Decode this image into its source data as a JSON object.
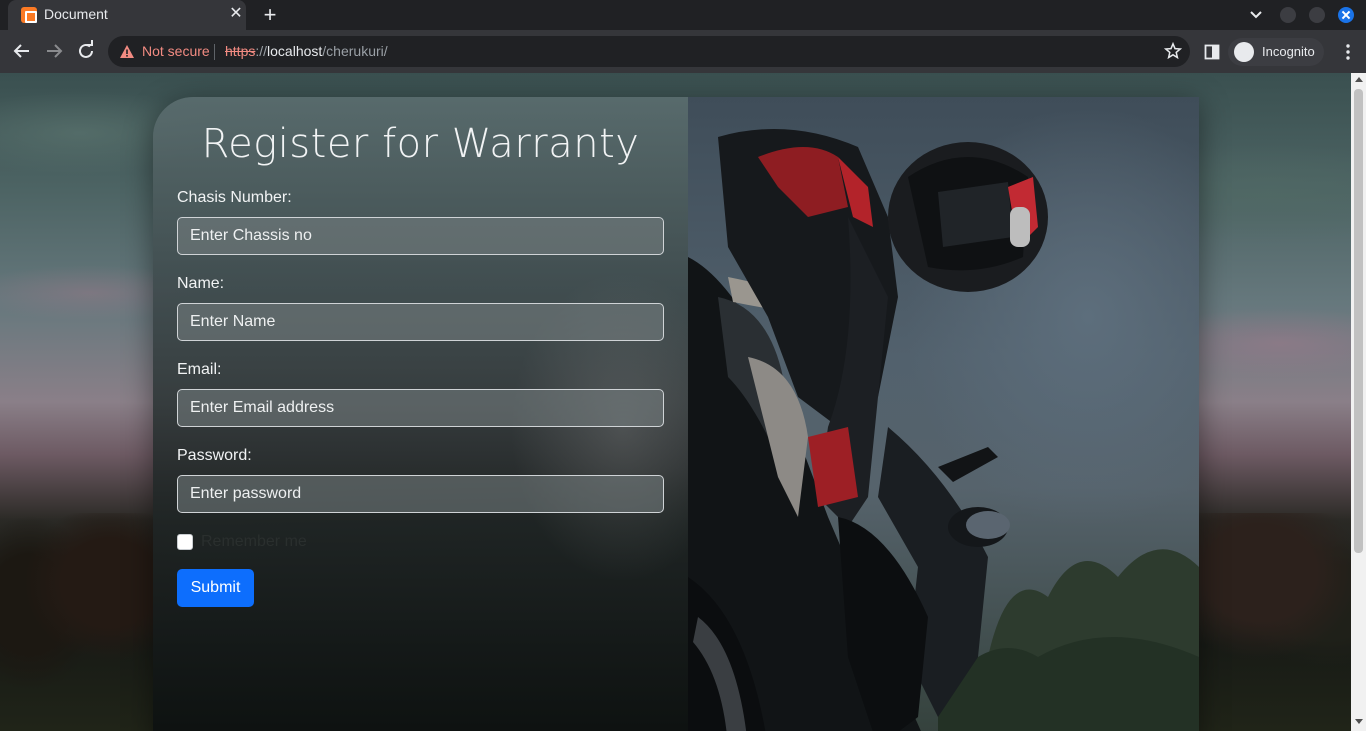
{
  "browser": {
    "tab_title": "Document",
    "tab_close_icon": "close-icon",
    "new_tab_icon": "plus-icon",
    "security_label": "Not secure",
    "url_scheme": "https",
    "url_separator": "://",
    "url_host": "localhost",
    "url_path": "/cherukuri/",
    "profile_label": "Incognito"
  },
  "form": {
    "title": "Register for Warranty",
    "chassis_label": "Chasis Number:",
    "chassis_placeholder": "Enter Chassis no",
    "name_label": "Name:",
    "name_placeholder": "Enter Name",
    "email_label": "Email:",
    "email_placeholder": "Enter Email address",
    "password_label": "Password:",
    "password_placeholder": "Enter password",
    "remember_label": "Remember me",
    "remember_checked": false,
    "submit_label": "Submit"
  },
  "colors": {
    "submit_button": "#0d6efd",
    "not_secure": "#f28b82"
  }
}
